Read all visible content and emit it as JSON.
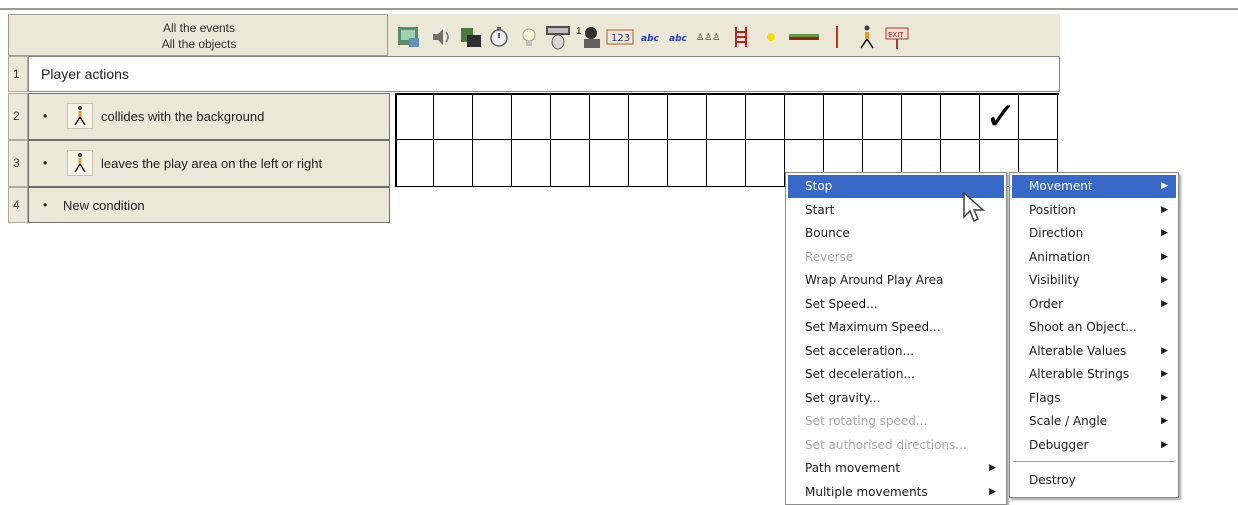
{
  "header": {
    "line1": "All the events",
    "line2": "All the objects"
  },
  "objects": [
    "storyboard-controls-icon",
    "sound-icon",
    "create-new-objects-icon",
    "timer-icon",
    "special-conditions-icon",
    "keyboard-mouse-icon",
    "player-icon",
    "counter-icon",
    "string-icon",
    "string-icon",
    "lives-icon",
    "ladder-icon",
    "bullet-icon",
    "platform-icon",
    "wall-icon",
    "player-character-icon",
    "exit-icon"
  ],
  "rows": [
    {
      "num": "1",
      "label": "Player actions"
    },
    {
      "num": "2",
      "label": "collides with the background"
    },
    {
      "num": "3",
      "label": "leaves the play area on the left or right"
    },
    {
      "num": "4",
      "label": "New condition"
    }
  ],
  "bullet": "•",
  "grid": {
    "checkmark": "✓",
    "checked_cell": {
      "row": 1,
      "col": 16
    }
  },
  "menu1": {
    "items": [
      {
        "label": "Stop",
        "state": "highlighted"
      },
      {
        "label": "Start"
      },
      {
        "label": "Bounce"
      },
      {
        "label": "Reverse",
        "state": "disabled"
      },
      {
        "label": "Wrap Around Play Area"
      },
      {
        "label": "Set Speed..."
      },
      {
        "label": "Set Maximum Speed..."
      },
      {
        "label": "Set acceleration..."
      },
      {
        "label": "Set deceleration..."
      },
      {
        "label": "Set gravity..."
      },
      {
        "label": "Set rotating speed...",
        "state": "disabled"
      },
      {
        "label": "Set authorised directions...",
        "state": "disabled"
      },
      {
        "label": "Path movement",
        "submenu": true
      },
      {
        "label": "Multiple movements",
        "submenu": true
      }
    ]
  },
  "menu2": {
    "items": [
      {
        "label": "Movement",
        "submenu": true,
        "state": "highlighted"
      },
      {
        "label": "Position",
        "submenu": true
      },
      {
        "label": "Direction",
        "submenu": true
      },
      {
        "label": "Animation",
        "submenu": true
      },
      {
        "label": "Visibility",
        "submenu": true
      },
      {
        "label": "Order",
        "submenu": true
      },
      {
        "label": "Shoot an Object..."
      },
      {
        "label": "Alterable Values",
        "submenu": true
      },
      {
        "label": "Alterable Strings",
        "submenu": true
      },
      {
        "label": "Flags",
        "submenu": true
      },
      {
        "label": "Scale / Angle",
        "submenu": true
      },
      {
        "label": "Debugger",
        "submenu": true
      },
      {
        "label": "Destroy"
      }
    ]
  },
  "submenu_arrow": "▶",
  "colors": {
    "highlight": "#3868c8",
    "panel": "#ece8d8"
  }
}
